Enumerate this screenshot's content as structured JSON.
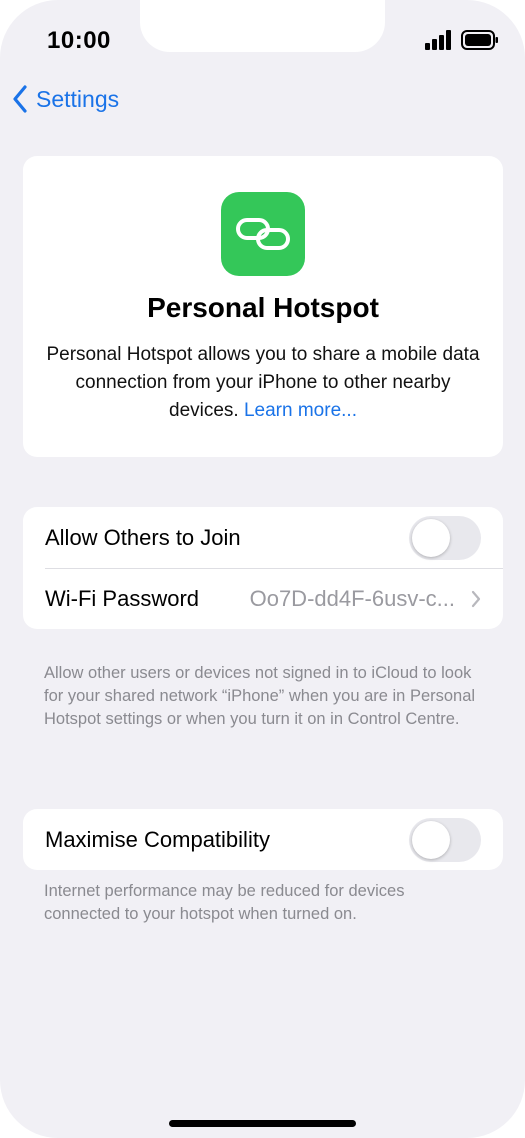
{
  "status_bar": {
    "time": "10:00"
  },
  "nav": {
    "back_label": "Settings"
  },
  "hero": {
    "title": "Personal Hotspot",
    "description": "Personal Hotspot allows you to share a mobile data connection from your iPhone to other nearby devices.",
    "link_text": "Learn more...",
    "icon": "link-icon",
    "icon_color": "#34c759"
  },
  "section1": {
    "allow_others": {
      "label": "Allow Others to Join",
      "enabled": false
    },
    "wifi_password": {
      "label": "Wi-Fi Password",
      "value": "Oo7D-dd4F-6usv-c..."
    },
    "footnote": "Allow other users or devices not signed in to iCloud to look for your shared network “iPhone” when you are in Personal Hotspot settings or when you turn it on in Control Centre."
  },
  "section2": {
    "maximise": {
      "label": "Maximise Compatibility",
      "enabled": false
    },
    "footnote": "Internet performance may be reduced for devices connected to your hotspot when turned on."
  },
  "colors": {
    "accent": "#1a73e8",
    "background": "#f1f0f5"
  }
}
